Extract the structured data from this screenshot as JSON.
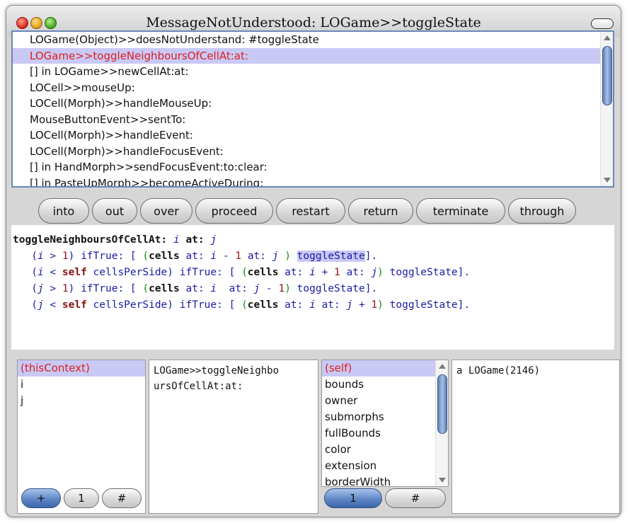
{
  "window": {
    "title": "MessageNotUnderstood: LOGame>>toggleState"
  },
  "stack": {
    "items": [
      "LOGame(Object)>>doesNotUnderstand: #toggleState",
      "LOGame>>toggleNeighboursOfCellAt:at:",
      "[] in LOGame>>newCellAt:at:",
      "LOCell>>mouseUp:",
      "LOCell(Morph)>>handleMouseUp:",
      "MouseButtonEvent>>sentTo:",
      "LOCell(Morph)>>handleEvent:",
      "LOCell(Morph)>>handleFocusEvent:",
      "[] in HandMorph>>sendFocusEvent:to:clear:",
      "[] in PasteUpMorph>>becomeActiveDuring:"
    ],
    "selected_index": 1
  },
  "buttons": [
    "into",
    "out",
    "over",
    "proceed",
    "restart",
    "return",
    "terminate",
    "through"
  ],
  "code": {
    "l1_selector": "toggleNeighboursOfCellAt:",
    "l1_i": "i",
    "l1_at": "at:",
    "l1_j": "j",
    "l2_open": "(",
    "l2_i": "i",
    "l2_gt": " > ",
    "l2_1": "1",
    "l2_close": ")",
    "l2_iftrue": " ifTrue: [ ",
    "l2_popen": "(",
    "l2_cells": "cells",
    "l2_at": " at: ",
    "l2_i2": "i",
    "l2_minus": " - ",
    "l2_one": "1",
    "l2_at2": " at: ",
    "l2_j": "j",
    "l2_pclose": " )",
    "l2_toggle": "toggleState",
    "l2_end": "].",
    "l3_open": "(",
    "l3_i": "i",
    "l3_lt": " < ",
    "l3_self": "self",
    "l3_cps": " cellsPerSide",
    "l3_close": ")",
    "l3_iftrue": " ifTrue: [ ",
    "l3_popen": "(",
    "l3_cells": "cells",
    "l3_at": " at: ",
    "l3_i2": "i",
    "l3_plus": " + ",
    "l3_one": "1",
    "l3_at2": " at: ",
    "l3_j": "j",
    "l3_pclose": ")",
    "l3_toggle": " toggleState",
    "l3_end": "].",
    "l4_open": "(",
    "l4_j": "j",
    "l4_gt": " > ",
    "l4_1": "1",
    "l4_close": ")",
    "l4_iftrue": " ifTrue: [ ",
    "l4_popen": "(",
    "l4_cells": "cells",
    "l4_at": " at: ",
    "l4_i": "i",
    "l4_at2": "  at: ",
    "l4_minus": " - ",
    "l4_one": "1",
    "l4_pclose": ")",
    "l4_toggle": " toggleState",
    "l4_end": "].",
    "l5_open": "(",
    "l5_j": "j",
    "l5_lt": " < ",
    "l5_self": "self",
    "l5_cps": " cellsPerSide",
    "l5_close": ")",
    "l5_iftrue": " ifTrue: [ ",
    "l5_popen": "(",
    "l5_cells": "cells",
    "l5_at": " at: ",
    "l5_i": "i",
    "l5_at2": " at: ",
    "l5_plus": " + ",
    "l5_one": "1",
    "l5_pclose": ")",
    "l5_toggle": " toggleState",
    "l5_end": "]."
  },
  "context_vars": {
    "items": [
      "(thisContext)",
      "i",
      "j"
    ],
    "selected_index": 0,
    "btn_plus": "+",
    "btn_one": "1",
    "btn_hash": "#"
  },
  "context_value": {
    "line1": "LOGame>>toggleNeighbo",
    "line2": "ursOfCellAt:at:"
  },
  "receiver_vars": {
    "items": [
      "(self)",
      "bounds",
      "owner",
      "submorphs",
      "fullBounds",
      "color",
      "extension",
      "borderWidth"
    ],
    "selected_index": 0,
    "btn_one": "1",
    "btn_hash": "#"
  },
  "receiver_value": {
    "text": "a LOGame(2146)"
  }
}
